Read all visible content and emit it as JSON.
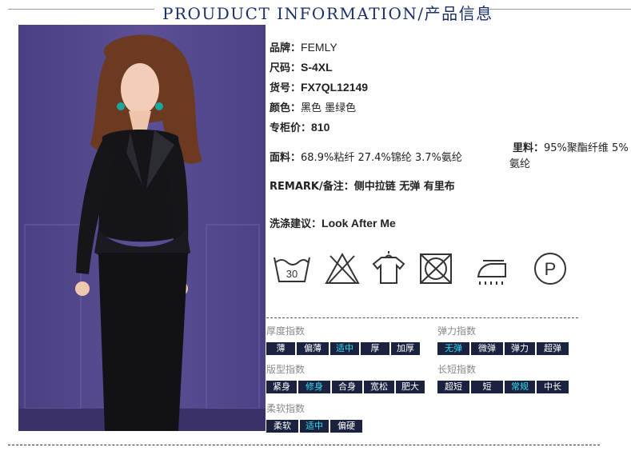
{
  "header": {
    "title": "PROUDUCT INFORMATION/产品信息"
  },
  "product": {
    "brand_label": "品牌：",
    "brand": "FEMLY",
    "size_label": "尺码：",
    "size": "S-4XL",
    "sku_label": "货号：",
    "sku": "FX7QL12149",
    "color_label": "颜色：",
    "color": "黑色 墨绿色",
    "price_label": "专柜价：",
    "price": "810",
    "fabric_label": "面料：",
    "fabric": "68.9%粘纤 27.4%锦纶 3.7%氨纶",
    "lining_label": "里料：",
    "lining_line1": "95%聚酯纤维 5%",
    "lining_line2": "氨纶",
    "remark_label": "REMARK/备注：",
    "remark": "侧中拉链 无弹 有里布",
    "wash_label": "洗涤建议：",
    "wash": "Look After Me"
  },
  "care_icons": [
    {
      "icon": "wash-30-icon",
      "text": "30"
    },
    {
      "icon": "no-bleach-icon"
    },
    {
      "icon": "hang-dry-icon"
    },
    {
      "icon": "no-tumble-dry-icon"
    },
    {
      "icon": "iron-icon"
    },
    {
      "icon": "dry-clean-p-icon",
      "text": "P"
    }
  ],
  "scales": {
    "thickness": {
      "title": "厚度指数",
      "options": [
        "薄",
        "偏薄",
        "适中",
        "厚",
        "加厚"
      ],
      "selected": "适中"
    },
    "elasticity": {
      "title": "弹力指数",
      "options": [
        "无弹",
        "微弹",
        "弹力",
        "超弹"
      ],
      "selected": "无弹"
    },
    "fit": {
      "title": "版型指数",
      "options": [
        "紧身",
        "修身",
        "合身",
        "宽松",
        "肥大"
      ],
      "selected": "修身"
    },
    "length": {
      "title": "长短指数",
      "options": [
        "超短",
        "短",
        "常规",
        "中长"
      ],
      "selected": "常规"
    },
    "softness": {
      "title": "柔软指数",
      "options": [
        "柔软",
        "适中",
        "偏硬"
      ],
      "selected": "适中"
    }
  },
  "colors": {
    "chip_bg": "#1a2240",
    "chip_selected_text": "#2de0ee",
    "title_color": "#1b2f6a"
  }
}
